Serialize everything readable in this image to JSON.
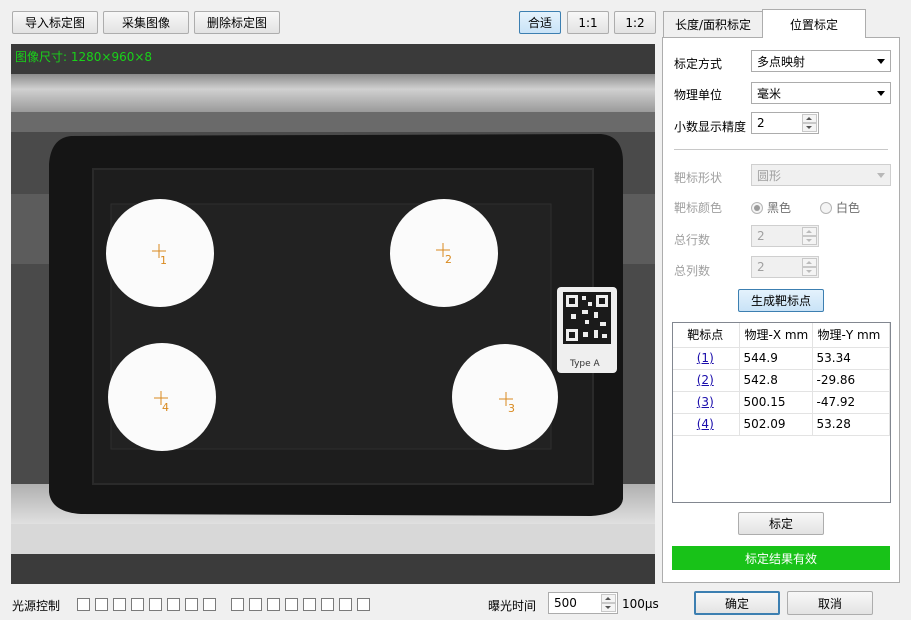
{
  "toolbar": {
    "import_label": "导入标定图",
    "capture_label": "采集图像",
    "delete_label": "删除标定图",
    "fit_label": "合适",
    "zoom_1_1": "1:1",
    "zoom_1_2": "1:2"
  },
  "viewer": {
    "image_size": "图像尺寸: 1280×960×8",
    "markers": [
      {
        "label": "1"
      },
      {
        "label": "2"
      },
      {
        "label": "3"
      },
      {
        "label": "4"
      }
    ],
    "qr_caption": "Type A"
  },
  "tabs": {
    "length_area": "长度/面积标定",
    "position": "位置标定"
  },
  "form": {
    "method_label": "标定方式",
    "method_value": "多点映射",
    "unit_label": "物理单位",
    "unit_value": "毫米",
    "precision_label": "小数显示精度",
    "precision_value": "2",
    "shape_label": "靶标形状",
    "shape_value": "圆形",
    "color_label": "靶标颜色",
    "color_black": "黑色",
    "color_white": "白色",
    "rows_label": "总行数",
    "rows_value": "2",
    "cols_label": "总列数",
    "cols_value": "2",
    "generate_label": "生成靶标点"
  },
  "table": {
    "headers": [
      "靶标点",
      "物理-X mm",
      "物理-Y mm"
    ],
    "rows": [
      {
        "idx": "(1)",
        "x": "544.9",
        "y": "53.34"
      },
      {
        "idx": "(2)",
        "x": "542.8",
        "y": "-29.86"
      },
      {
        "idx": "(3)",
        "x": "500.15",
        "y": "-47.92"
      },
      {
        "idx": "(4)",
        "x": "502.09",
        "y": "53.28"
      }
    ]
  },
  "calibrate_label": "标定",
  "status": {
    "text": "标定结果有效",
    "color": "#18c218"
  },
  "bottom": {
    "light_label": "光源控制",
    "exposure_label": "曝光时间",
    "exposure_value": "500",
    "exposure_unit": "100μs",
    "ok_label": "确定",
    "cancel_label": "取消"
  }
}
